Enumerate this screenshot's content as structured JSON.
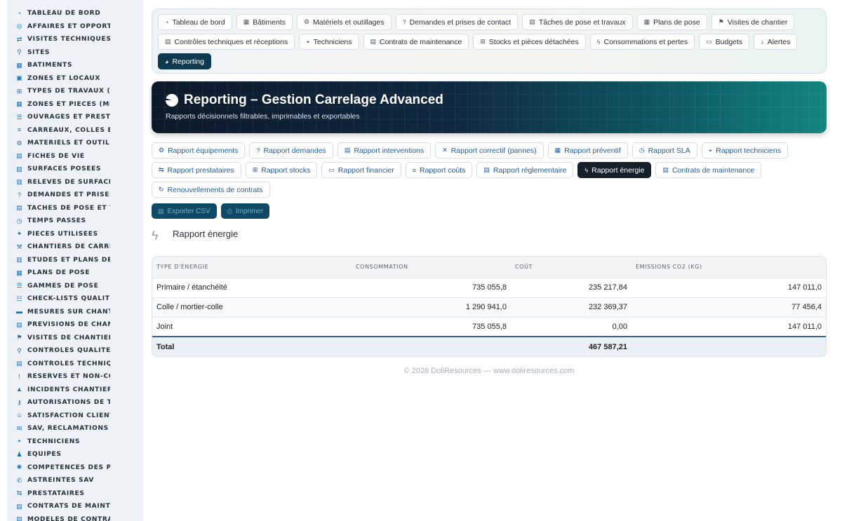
{
  "sidebar": {
    "items": [
      {
        "label": "Tableau de bord",
        "icon": "dashboard-icon",
        "glyph": "◔"
      },
      {
        "label": "Affaires et opportun",
        "icon": "target-icon",
        "glyph": "◎"
      },
      {
        "label": "Visites techniques et",
        "icon": "route-icon",
        "glyph": "⇄"
      },
      {
        "label": "Sites",
        "icon": "map-pin-icon",
        "glyph": "⚲"
      },
      {
        "label": "Bâtiments",
        "icon": "building-icon",
        "glyph": "▦"
      },
      {
        "label": "Zones et locaux",
        "icon": "grid-icon",
        "glyph": "▣"
      },
      {
        "label": "Types de travaux (sol",
        "icon": "sitemap-icon",
        "glyph": "⊞"
      },
      {
        "label": "Zones et pièces (métr",
        "icon": "grid-icon",
        "glyph": "▦"
      },
      {
        "label": "Ouvrages et prestati",
        "icon": "list-icon",
        "glyph": "☰"
      },
      {
        "label": "Carreaux, colles et j",
        "icon": "layers-icon",
        "glyph": "≡"
      },
      {
        "label": "Matériels et outillag",
        "icon": "cogs-icon",
        "glyph": "⚙"
      },
      {
        "label": "Fiches de vie",
        "icon": "file-icon",
        "glyph": "▤"
      },
      {
        "label": "Surfaces posées",
        "icon": "layers-icon",
        "glyph": "▧"
      },
      {
        "label": "Relevés de surfaces",
        "icon": "ruler-icon",
        "glyph": "▥"
      },
      {
        "label": "Demandes et prises d",
        "icon": "question-icon",
        "glyph": "?"
      },
      {
        "label": "Tâches de pose et tra",
        "icon": "clipboard-icon",
        "glyph": "▤"
      },
      {
        "label": "Temps passés",
        "icon": "clock-icon",
        "glyph": "◷"
      },
      {
        "label": "Pièces utilisées",
        "icon": "puzzle-icon",
        "glyph": "✦"
      },
      {
        "label": "Chantiers de carrela",
        "icon": "hammer-icon",
        "glyph": "⚒"
      },
      {
        "label": "Études et plans de ca",
        "icon": "book-icon",
        "glyph": "▥"
      },
      {
        "label": "Plans de pose",
        "icon": "calendar-icon",
        "glyph": "▦"
      },
      {
        "label": "Gammes de pose",
        "icon": "list-icon",
        "glyph": "☰"
      },
      {
        "label": "Check-lists qualité",
        "icon": "checklist-icon",
        "glyph": "☷"
      },
      {
        "label": "Mesures sur chantier",
        "icon": "ruler-icon",
        "glyph": "▬"
      },
      {
        "label": "Prévisions de chantie",
        "icon": "chart-icon",
        "glyph": "▤"
      },
      {
        "label": "Visites de chantier",
        "icon": "walk-icon",
        "glyph": "⚑"
      },
      {
        "label": "Contrôles qualité",
        "icon": "search-icon",
        "glyph": "⚲"
      },
      {
        "label": "Contrôles technique",
        "icon": "clipboard-check-icon",
        "glyph": "▤"
      },
      {
        "label": "Réserves et non-conf",
        "icon": "alert-circle-icon",
        "glyph": "!"
      },
      {
        "label": "Incidents chantier",
        "icon": "warning-icon",
        "glyph": "▲"
      },
      {
        "label": "Autorisations de trav",
        "icon": "key-icon",
        "glyph": "⚷"
      },
      {
        "label": "Satisfaction client",
        "icon": "smile-icon",
        "glyph": "☺"
      },
      {
        "label": "SAV, réclamations et",
        "icon": "comment-icon",
        "glyph": "✉"
      },
      {
        "label": "Techniciens",
        "icon": "hard-hat-icon",
        "glyph": "◓"
      },
      {
        "label": "Équipes",
        "icon": "users-icon",
        "glyph": "♟"
      },
      {
        "label": "Compétences des pos",
        "icon": "badge-icon",
        "glyph": "✺"
      },
      {
        "label": "Astreintes SAV",
        "icon": "phone-icon",
        "glyph": "✆"
      },
      {
        "label": "Prestataires",
        "icon": "handshake-icon",
        "glyph": "⇆"
      },
      {
        "label": "Contrats de maintena",
        "icon": "file-contract-icon",
        "glyph": "▤"
      },
      {
        "label": "Modèles de contrats",
        "icon": "file-icon",
        "glyph": "▤"
      }
    ]
  },
  "topnav": {
    "row1": [
      {
        "label": "Tableau de bord",
        "glyph": "◔",
        "icon": "dashboard-icon"
      },
      {
        "label": "Bâtiments",
        "glyph": "▦",
        "icon": "building-icon"
      },
      {
        "label": "Matériels et outillages",
        "glyph": "⚙",
        "icon": "cogs-icon"
      },
      {
        "label": "Demandes et prises de contact",
        "glyph": "?",
        "icon": "question-icon"
      },
      {
        "label": "Tâches de pose et travaux",
        "glyph": "▤",
        "icon": "clipboard-icon"
      },
      {
        "label": "Plans de pose",
        "glyph": "▦",
        "icon": "calendar-icon"
      },
      {
        "label": "Visites de chantier",
        "glyph": "⚑",
        "icon": "walk-icon"
      }
    ],
    "row2": [
      {
        "label": "Contrôles techniques et réceptions",
        "glyph": "▤",
        "icon": "clipboard-check-icon"
      },
      {
        "label": "Techniciens",
        "glyph": "◓",
        "icon": "hard-hat-icon"
      },
      {
        "label": "Contrats de maintenance",
        "glyph": "▤",
        "icon": "file-contract-icon"
      },
      {
        "label": "Stocks et pièces détachées",
        "glyph": "⊞",
        "icon": "boxes-icon"
      },
      {
        "label": "Consommations et pertes",
        "glyph": "ϟ",
        "icon": "bolt-icon"
      },
      {
        "label": "Budgets",
        "glyph": "▭",
        "icon": "money-icon"
      },
      {
        "label": "Alertes",
        "glyph": "♪",
        "icon": "bell-icon"
      }
    ],
    "row3": [
      {
        "label": "Reporting",
        "glyph": "◕",
        "icon": "pie-chart-icon",
        "active": true
      }
    ]
  },
  "banner": {
    "title": "Reporting – Gestion Carrelage Advanced",
    "subtitle": "Rapports décisionnels filtrables, imprimables et exportables"
  },
  "subnav": {
    "row1": [
      {
        "label": "Rapport équipements",
        "glyph": "⚙",
        "icon": "cogs-icon"
      },
      {
        "label": "Rapport demandes",
        "glyph": "?",
        "icon": "question-icon"
      },
      {
        "label": "Rapport interventions",
        "glyph": "▤",
        "icon": "clipboard-icon"
      },
      {
        "label": "Rapport correctif (pannes)",
        "glyph": "✕",
        "icon": "tools-icon"
      },
      {
        "label": "Rapport préventif",
        "glyph": "▦",
        "icon": "calendar-icon"
      },
      {
        "label": "Rapport SLA",
        "glyph": "◷",
        "icon": "stopwatch-icon"
      },
      {
        "label": "Rapport techniciens",
        "glyph": "◓",
        "icon": "hard-hat-icon"
      }
    ],
    "row2": [
      {
        "label": "Rapport prestataires",
        "glyph": "⇆",
        "icon": "handshake-icon"
      },
      {
        "label": "Rapport stocks",
        "glyph": "⊞",
        "icon": "boxes-icon"
      },
      {
        "label": "Rapport financier",
        "glyph": "▭",
        "icon": "money-icon"
      },
      {
        "label": "Rapport coûts",
        "glyph": "≡",
        "icon": "coins-icon"
      },
      {
        "label": "Rapport réglementaire",
        "glyph": "▤",
        "icon": "clipboard-check-icon"
      },
      {
        "label": "Rapport énergie",
        "glyph": "ϟ",
        "icon": "bolt-icon",
        "active": true
      },
      {
        "label": "Contrats de maintenance",
        "glyph": "▤",
        "icon": "file-contract-icon"
      }
    ],
    "row3": [
      {
        "label": "Renouvellements de contrats",
        "glyph": "↻",
        "icon": "refresh-icon"
      }
    ]
  },
  "actions": {
    "export_label": "Exporter CSV",
    "print_label": "Imprimer"
  },
  "report": {
    "title": "Rapport énergie",
    "columns": [
      "Type d'énergie",
      "Consommation",
      "Coût",
      "Émissions CO2 (kg)"
    ],
    "rows": [
      {
        "type": "Primaire / étanchéité",
        "consommation": "735 055,8",
        "cout": "235 217,84",
        "emissions": "147 011,0"
      },
      {
        "type": "Colle / mortier-colle",
        "consommation": "1 290 941,0",
        "cout": "232 369,37",
        "emissions": "77 456,4"
      },
      {
        "type": "Joint",
        "consommation": "735 055,8",
        "cout": "0,00",
        "emissions": "147 011,0"
      }
    ],
    "total_label": "Total",
    "total_cout": "467 587,21"
  },
  "footer": {
    "text": "© 2026 DoliResources — www.doliresources.com"
  }
}
